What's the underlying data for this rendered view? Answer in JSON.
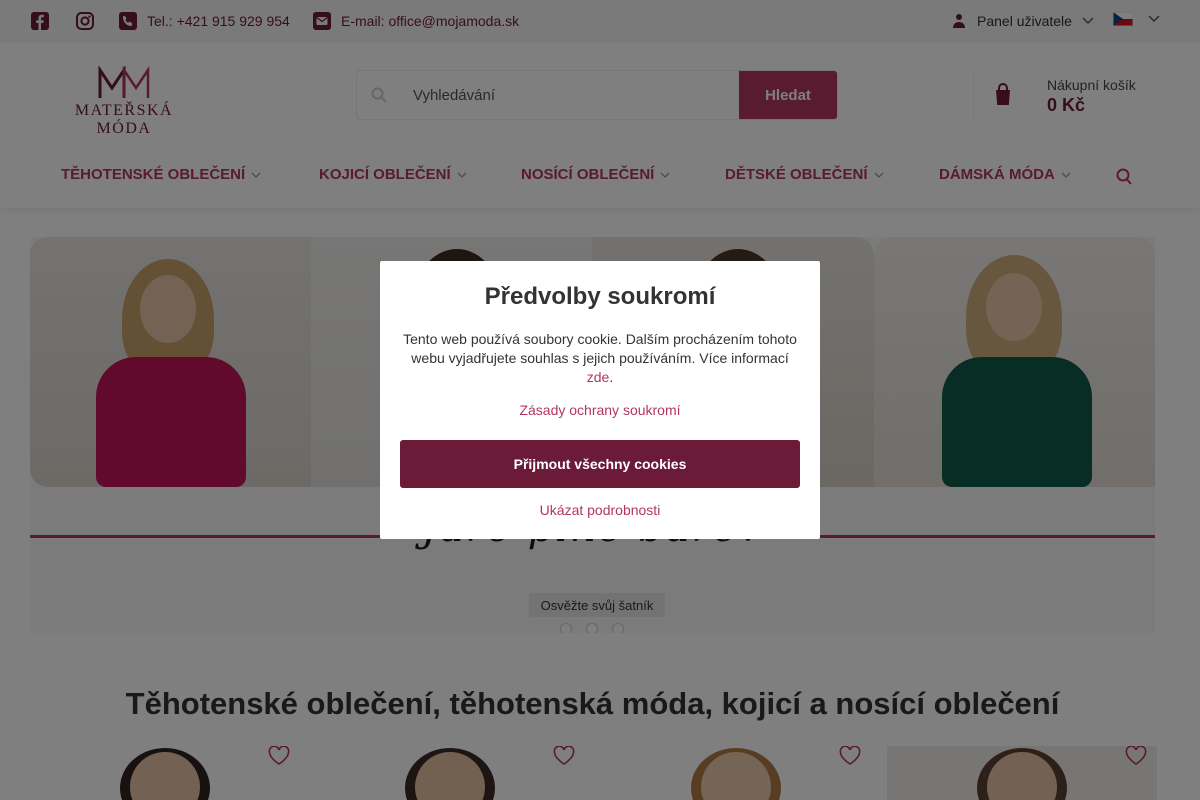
{
  "topbar": {
    "social": [
      {
        "icon": "facebook-icon"
      },
      {
        "icon": "instagram-icon"
      }
    ],
    "phone": "Tel.: +421 915 929 954",
    "email": "E-mail: office@mojamoda.sk",
    "user_panel": "Panel uživatele",
    "language_flag": "czech-flag-icon"
  },
  "header": {
    "logo_text": "MATEŘSKÁ MÓDA",
    "search_placeholder": "Vyhledávání",
    "search_button": "Hledat",
    "cart_label": "Nákupní košík",
    "cart_total": "0 Kč"
  },
  "nav": {
    "items": [
      {
        "label": "TĚHOTENSKÉ OBLEČENÍ"
      },
      {
        "label": "KOJICÍ OBLEČENÍ"
      },
      {
        "label": "NOSÍCÍ OBLEČENÍ"
      },
      {
        "label": "DĚTSKÉ OBLEČENÍ"
      },
      {
        "label": "DÁMSKÁ MÓDA"
      }
    ]
  },
  "banner": {
    "script_text": "Jaro plné barev",
    "cta": "Osvěžte svůj šatník",
    "active_slide": 1,
    "slide_count": 3
  },
  "cookie_modal": {
    "title": "Předvolby soukromí",
    "text": "Tento web používá soubory cookie. Dalším procházením tohoto webu vyjadřujete souhlas s jejich používáním. Více informací",
    "link": "zde",
    "privacy_link": "Zásady ochrany soukromí",
    "accept_button": "Přijmout všechny cookies",
    "details_link": "Ukázat podrobnosti"
  },
  "section": {
    "title": "Těhotenské oblečení, těhotenská móda, kojicí a nosící oblečení"
  },
  "colors": {
    "brand": "#b3365e",
    "brand_dark": "#6b1b38",
    "overlay": "rgba(0,0,0,0.5)"
  }
}
